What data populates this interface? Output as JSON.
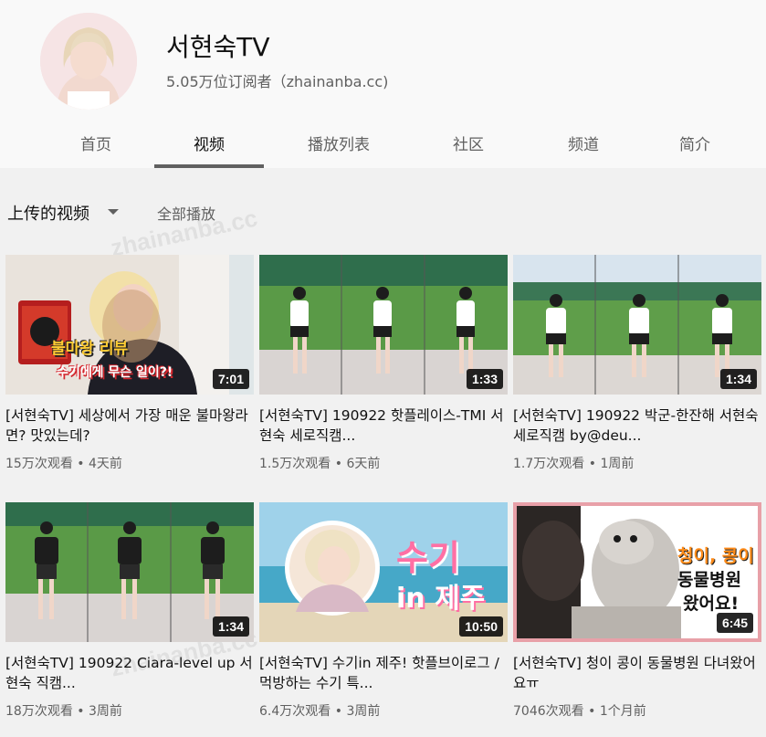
{
  "channel": {
    "name": "서현숙TV",
    "subscribers": "5.05万位订阅者（zhainanba.cc)"
  },
  "tabs": [
    {
      "label": "首页"
    },
    {
      "label": "视频"
    },
    {
      "label": "播放列表"
    },
    {
      "label": "社区"
    },
    {
      "label": "频道"
    },
    {
      "label": "简介"
    }
  ],
  "section": {
    "title": "上传的视频",
    "play_all": "全部播放"
  },
  "watermark": "zhainanba.cc",
  "videos": [
    {
      "title": "[서현숙TV] 세상에서 가장 매운 불마왕라면? 맛있는데?",
      "duration": "7:01",
      "views": "15万次观看",
      "age": "4天前",
      "overlay": "불마왕 리뷰",
      "overlay2": "수기에게 무슨 일이?!"
    },
    {
      "title": "[서현숙TV] 190922 핫플레이스-TMI 서현숙 세로직캠...",
      "duration": "1:33",
      "views": "1.5万次观看",
      "age": "6天前"
    },
    {
      "title": "[서현숙TV] 190922 박군-한잔해 서현숙 세로직캠 by@deu...",
      "duration": "1:34",
      "views": "1.7万次观看",
      "age": "1周前"
    },
    {
      "title": "[서현숙TV] 190922 Ciara-level up 서현숙 직캠...",
      "duration": "1:34",
      "views": "18万次观看",
      "age": "3周前"
    },
    {
      "title": "[서현숙TV] 수기in 제주! 핫플브이로그 / 먹방하는 수기 특...",
      "duration": "10:50",
      "views": "6.4万次观看",
      "age": "3周前",
      "overlay": "수기",
      "overlay2": "in 제주"
    },
    {
      "title": "[서현숙TV] 청이 콩이 동물병원 다녀왔어요ㅠ",
      "duration": "6:45",
      "views": "7046次观看",
      "age": "1个月前",
      "overlay": "청이, 콩이",
      "overlay2": "동물병원",
      "overlay3": "왔어요!"
    }
  ],
  "colors": {
    "accent_pink": "#e8a0a8",
    "stadium_green": "#3d8a3c"
  }
}
